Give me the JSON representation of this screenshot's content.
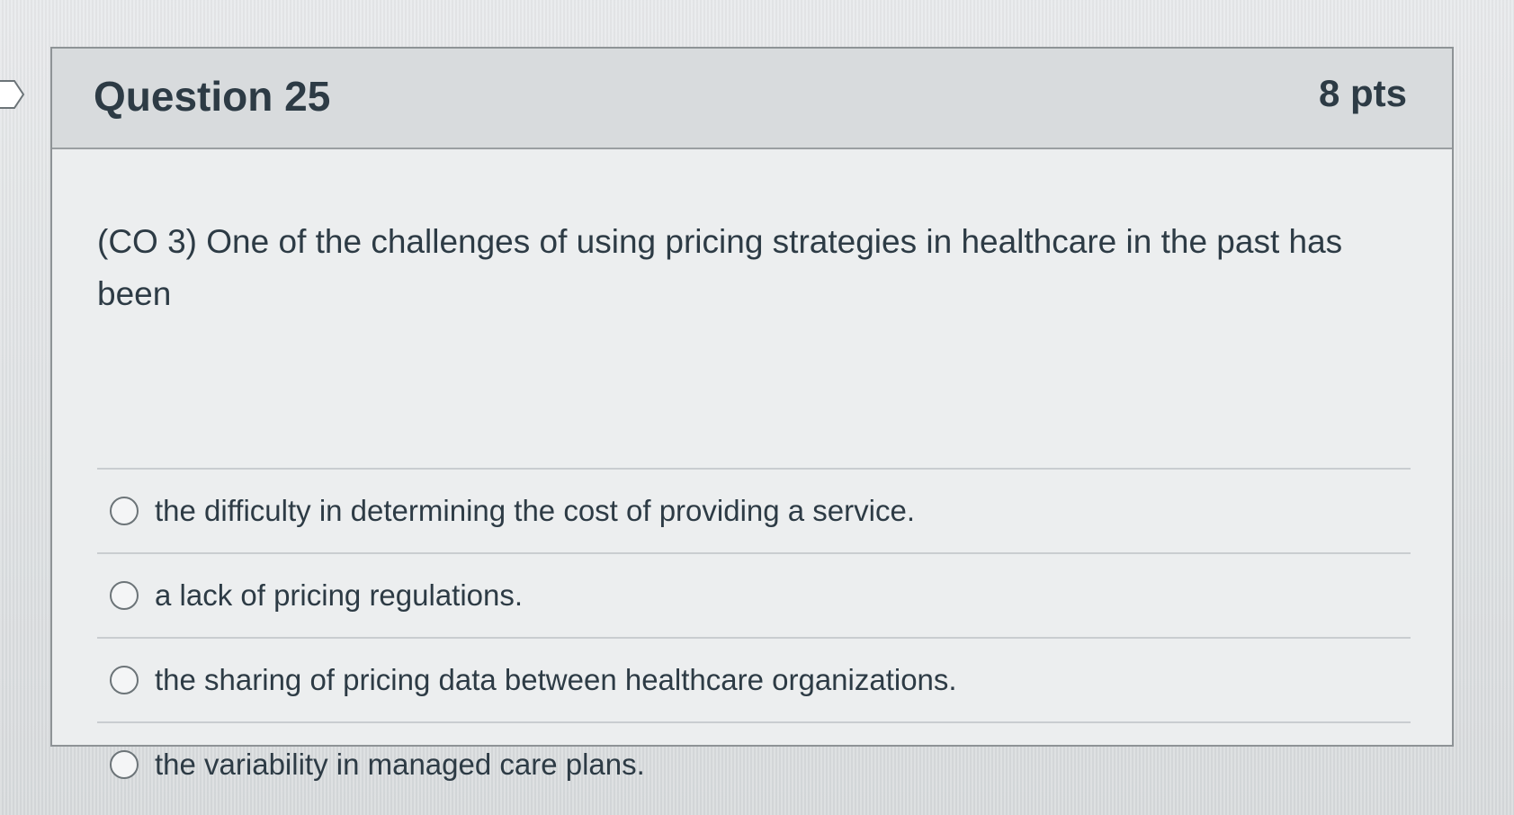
{
  "question": {
    "title": "Question 25",
    "points": "8 pts",
    "text": "(CO 3) One of the challenges of using pricing strategies in healthcare in the past has been",
    "answers": [
      {
        "label": "the difficulty in determining the cost of providing a service.",
        "selected": false
      },
      {
        "label": "a lack of pricing regulations.",
        "selected": false
      },
      {
        "label": "the sharing of pricing data between healthcare organizations.",
        "selected": false
      },
      {
        "label": "the variability in managed care plans.",
        "selected": false
      }
    ]
  },
  "icons": {
    "flag": "flag-marker-icon",
    "radio": "radio-unselected-icon"
  },
  "colors": {
    "text": "#2d3b45",
    "header_bg": "#d8dbdd",
    "card_bg": "#eceeef",
    "border": "#8e9396"
  }
}
